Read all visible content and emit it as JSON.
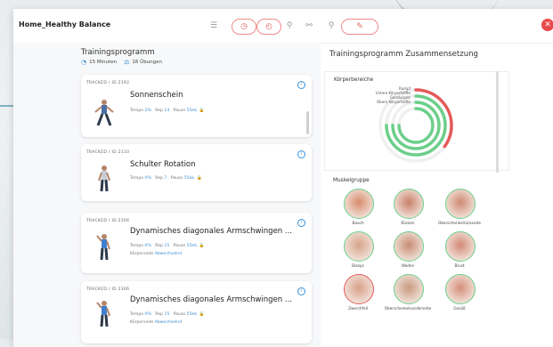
{
  "app_title": "Home_Healthy Balance",
  "toolbar": {
    "close_label": "✕"
  },
  "program": {
    "title": "Trainingsprogramm",
    "duration": "15 Minuten",
    "exercises": "16 Übungen"
  },
  "params_labels": {
    "tempo": "Tempo",
    "rep": "Rep",
    "pause": "Pause",
    "side": "Körperseite"
  },
  "cards": [
    {
      "tracked": "TRACKED / ID 2192",
      "name": "Sonnenschein",
      "tempo": "2%",
      "rep": "14",
      "pause": "55ek."
    },
    {
      "tracked": "TRACKED / ID 2110",
      "name": "Schulter Rotation",
      "tempo": "0%",
      "rep": "7",
      "pause": "55ek."
    },
    {
      "tracked": "TRACKED / ID 2306",
      "name": "Dynamisches diagonales Armschwingen ...",
      "tempo": "0%",
      "rep": "15",
      "pause": "55ek.",
      "side": "Abwechselnd"
    },
    {
      "tracked": "TRACKED / ID 2306",
      "name": "Dynamisches diagonales Armschwingen ...",
      "tempo": "0%",
      "rep": "15",
      "pause": "55ek.",
      "side": "Abwechselnd"
    }
  ],
  "composition": {
    "title": "Trainingsprogramm Zusammensetzung",
    "body_areas_label": "Körperbereiche",
    "rings": [
      {
        "label": "Rumpf",
        "fraction": 0.35,
        "color": "#e55a5a"
      },
      {
        "label": "Untere Körperhälfte",
        "fraction": 0.75,
        "color": "#6ccf8a"
      },
      {
        "label": "Ganzkörper",
        "fraction": 0.75,
        "color": "#6ccf8a"
      },
      {
        "label": "Obere Körperhälfte",
        "fraction": 0.75,
        "color": "#6ccf8a"
      }
    ],
    "muscle_group_label": "Muskelgruppe",
    "muscles": [
      {
        "label": "Bauch",
        "status": "green"
      },
      {
        "label": "Rücken",
        "status": "green"
      },
      {
        "label": "Oberschenkelrückseite",
        "status": "green"
      },
      {
        "label": "Bizeps",
        "status": "green"
      },
      {
        "label": "Waden",
        "status": "green"
      },
      {
        "label": "Brust",
        "status": "green"
      },
      {
        "label": "Zwerchfell",
        "status": "red"
      },
      {
        "label": "Oberschenkelvorderseite",
        "status": "green"
      },
      {
        "label": "Gesäß",
        "status": "green"
      }
    ]
  },
  "colors": {
    "accent": "#3a90d6",
    "danger": "#e84b4b",
    "ring_green": "#6ccf8a",
    "ring_red": "#e55a5a"
  }
}
